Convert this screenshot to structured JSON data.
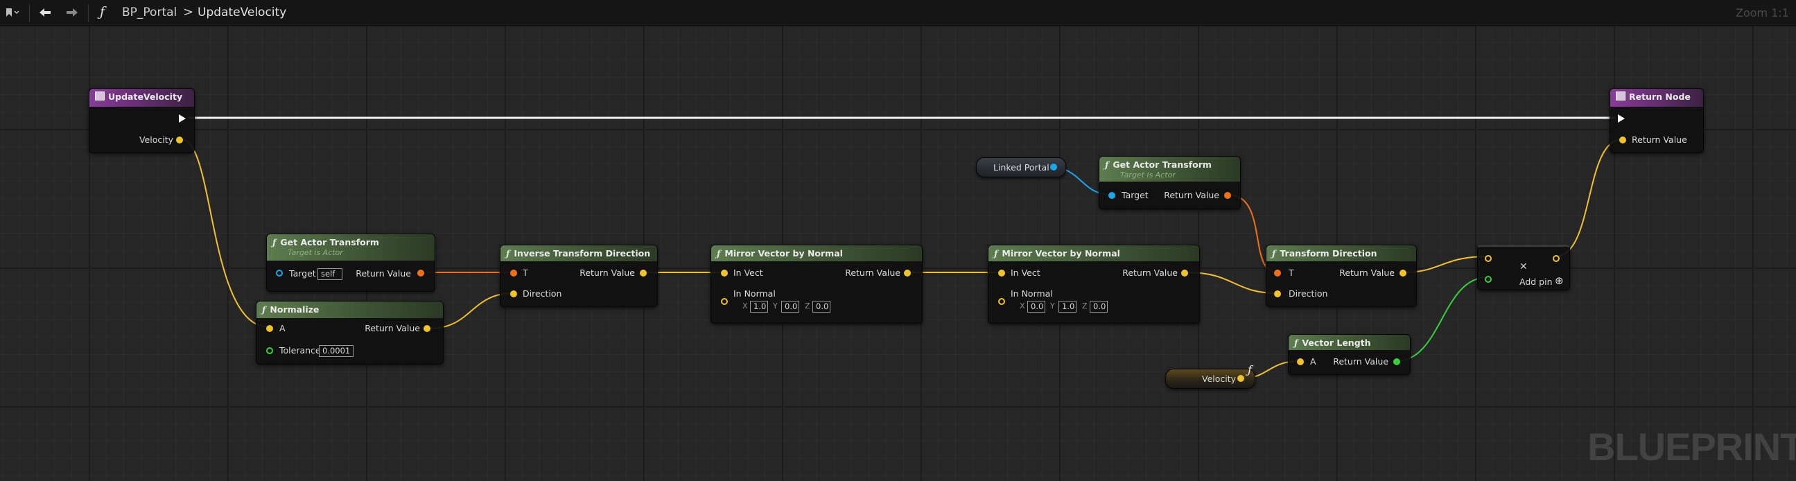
{
  "toolbar": {
    "function_symbol": "ƒ",
    "breadcrumb_class": "BP_Portal",
    "breadcrumb_separator": ">",
    "breadcrumb_function": "UpdateVelocity",
    "zoom": "Zoom 1:1"
  },
  "watermark": "BLUEPRINT",
  "nodes": {
    "entry": {
      "title": "UpdateVelocity",
      "pin_velocity": "Velocity"
    },
    "return": {
      "title": "Return Node",
      "pin_return": "Return Value"
    },
    "get_transform_1": {
      "title": "Get Actor Transform",
      "subtitle": "Target is Actor",
      "pin_target": "Target",
      "target_value": "self",
      "pin_return": "Return Value"
    },
    "normalize": {
      "title": "Normalize",
      "pin_a": "A",
      "pin_tolerance": "Tolerance",
      "tolerance_value": "0.0001",
      "pin_return": "Return Value"
    },
    "inverse_transform": {
      "title": "Inverse Transform Direction",
      "pin_t": "T",
      "pin_direction": "Direction",
      "pin_return": "Return Value"
    },
    "mirror_1": {
      "title": "Mirror Vector by Normal",
      "pin_in_vect": "In Vect",
      "pin_in_normal": "In Normal",
      "pin_return": "Return Value",
      "x_label": "X",
      "x_value": "1.0",
      "y_label": "Y",
      "y_value": "0.0",
      "z_label": "Z",
      "z_value": "0.0"
    },
    "mirror_2": {
      "title": "Mirror Vector by Normal",
      "pin_in_vect": "In Vect",
      "pin_in_normal": "In Normal",
      "pin_return": "Return Value",
      "x_label": "X",
      "x_value": "0.0",
      "y_label": "Y",
      "y_value": "1.0",
      "z_label": "Z",
      "z_value": "0.0"
    },
    "linked_portal": {
      "label": "Linked Portal"
    },
    "get_transform_2": {
      "title": "Get Actor Transform",
      "subtitle": "Target is Actor",
      "pin_target": "Target",
      "pin_return": "Return Value"
    },
    "transform_direction": {
      "title": "Transform Direction",
      "pin_t": "T",
      "pin_direction": "Direction",
      "pin_return": "Return Value"
    },
    "velocity_var": {
      "label": "Velocity",
      "glyph": "ƒ"
    },
    "vector_length": {
      "title": "Vector Length",
      "pin_a": "A",
      "pin_return": "Return Value"
    },
    "make_struct": {
      "add_pin": "Add pin",
      "close_glyph": "✕",
      "add_glyph": "⊕"
    }
  },
  "colors": {
    "transform_pin": "#f0701a",
    "vector_pin": "#f2c22a",
    "object_pin": "#1aa7ec",
    "float_pin": "#37d13a",
    "exec_wire": "#ffffff",
    "pure_header": "#4b6641",
    "event_header": "#7a3a88"
  }
}
